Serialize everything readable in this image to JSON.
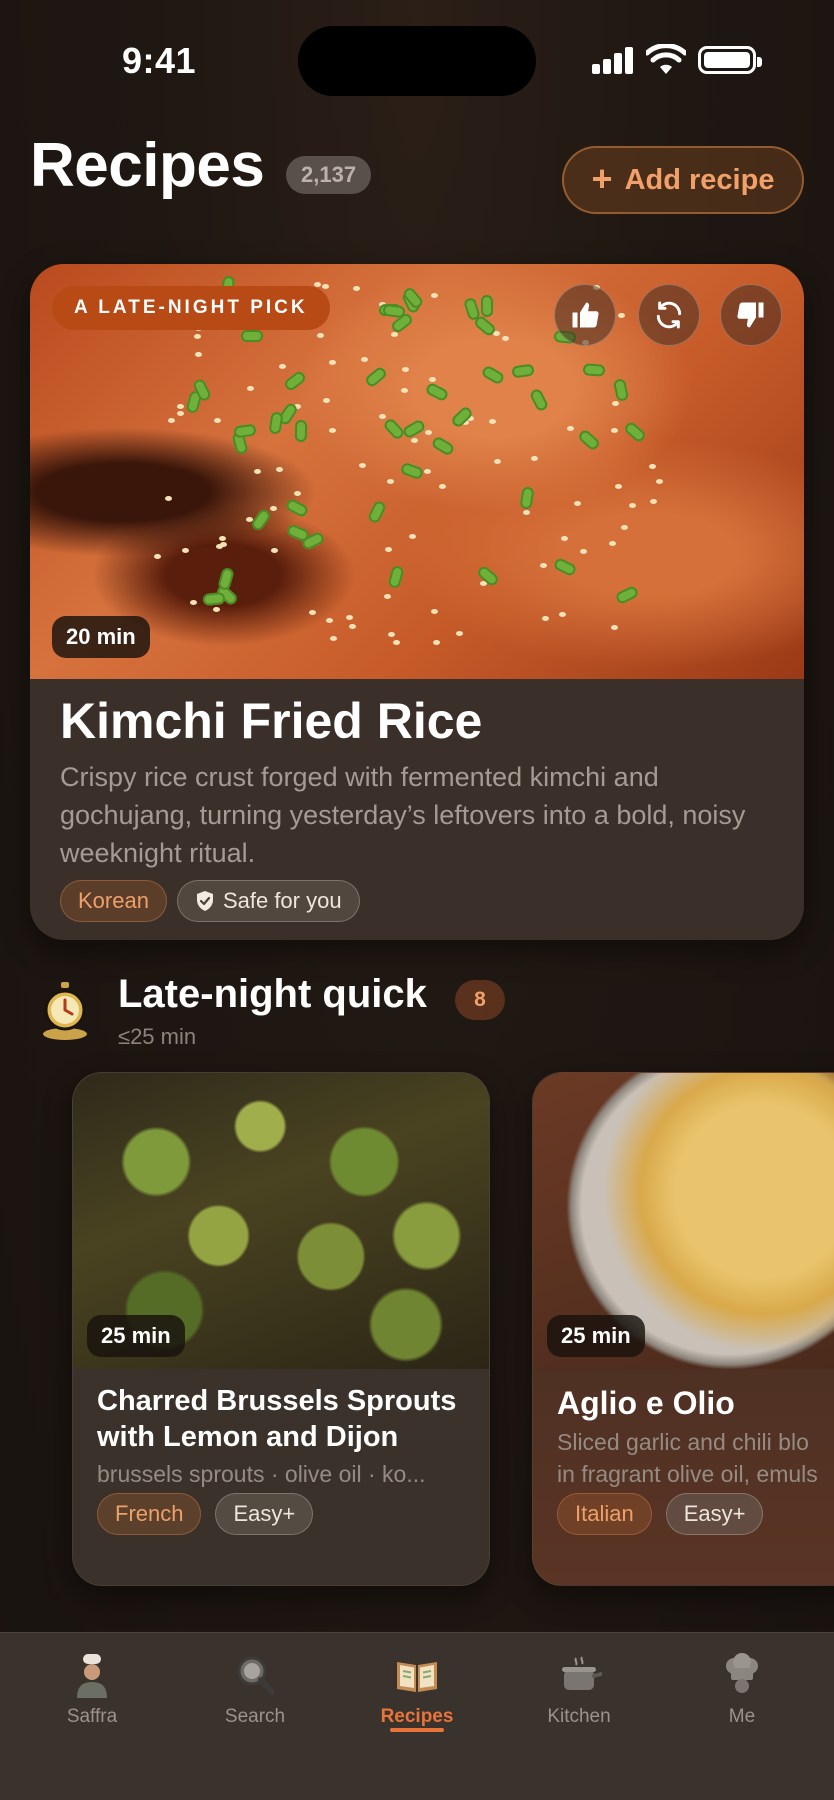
{
  "status_bar": {
    "time": "9:41"
  },
  "header": {
    "title": "Recipes",
    "count": "2,137",
    "add_button": {
      "icon": "plus-icon",
      "label": "Add recipe"
    }
  },
  "featured": {
    "badge": "A LATE-NIGHT PICK",
    "actions": [
      "thumbs-up-icon",
      "refresh-icon",
      "thumbs-down-icon"
    ],
    "time": "20 min",
    "title": "Kimchi Fried Rice",
    "description": "Crispy rice crust forged with fermented kimchi and gochujang, turning yesterday’s leftovers into a bold, noisy weeknight ritual.",
    "tags": {
      "cuisine": "Korean",
      "safety": {
        "icon": "shield-check-icon",
        "label": "Safe for you"
      }
    }
  },
  "section": {
    "icon": "stopwatch-icon",
    "title": "Late-night quick",
    "count": "8",
    "subtitle": "≤25 min",
    "cards": [
      {
        "time": "25 min",
        "title_line1": "Charred Brussels Sprouts",
        "title_line2": "with Lemon and Dijon",
        "description": "brussels sprouts · olive oil · ko...",
        "cuisine": "French",
        "difficulty": "Easy+"
      },
      {
        "time": "25 min",
        "title": "Aglio e Olio",
        "description_line1": "Sliced garlic and chili blo",
        "description_line2": "in fragrant olive oil, emuls",
        "cuisine": "Italian",
        "difficulty": "Easy+"
      }
    ]
  },
  "tab_bar": {
    "active": "Recipes",
    "items": [
      {
        "icon": "chef-avatar-icon",
        "label": "Saffra"
      },
      {
        "icon": "search-icon",
        "label": "Search"
      },
      {
        "icon": "open-book-icon",
        "label": "Recipes"
      },
      {
        "icon": "pot-icon",
        "label": "Kitchen"
      },
      {
        "icon": "chef-hat-icon",
        "label": "Me"
      }
    ]
  },
  "colors": {
    "accent": "#e8743a",
    "background": "#1d1612",
    "card": "#3a3029"
  }
}
